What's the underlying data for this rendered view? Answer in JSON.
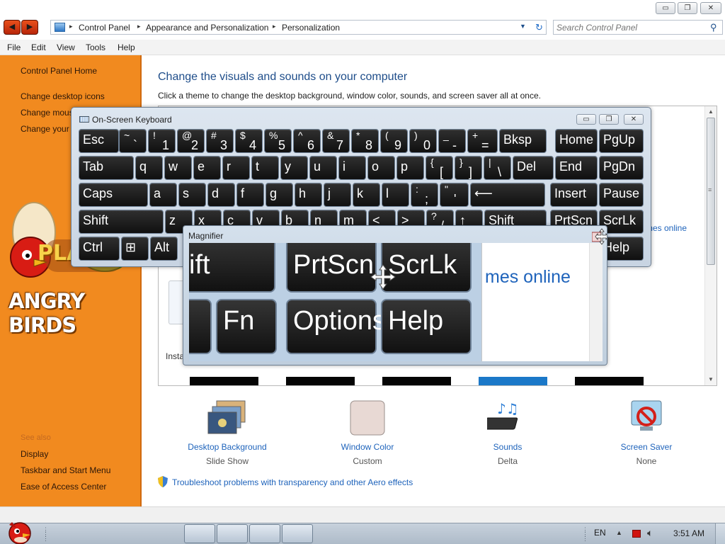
{
  "window": {
    "controls": {
      "minimize": "▭",
      "maximize": "❐",
      "close": "✕"
    }
  },
  "address": {
    "crumbs": [
      "Control Panel",
      "Appearance and Personalization",
      "Personalization"
    ],
    "arrow": "▸",
    "dropdown": "▼",
    "refresh": "↻"
  },
  "search": {
    "placeholder": "Search Control Panel",
    "icon": "search-icon"
  },
  "menu": [
    "File",
    "Edit",
    "View",
    "Tools",
    "Help"
  ],
  "sidebar": {
    "links": [
      "Control Panel Home",
      "Change desktop icons",
      "Change mouse pointers",
      "Change your account picture"
    ],
    "see_also_title": "See also",
    "see_also": [
      "Display",
      "Taskbar and Start Menu",
      "Ease of Access Center"
    ],
    "art_play": "PLAY",
    "art_title": "ANGRY BIRDS"
  },
  "main": {
    "title": "Change the visuals and sounds on your computer",
    "description": "Click a theme to change the desktop background, window color, sounds, and screen saver all at once.",
    "themes_online": "mes online",
    "installed_label": "Insta",
    "bottom_items": [
      {
        "label": "Desktop Background",
        "sub": "Slide Show",
        "icon": "desktop-background-icon"
      },
      {
        "label": "Window Color",
        "sub": "Custom",
        "icon": "window-color-icon"
      },
      {
        "label": "Sounds",
        "sub": "Delta",
        "icon": "sounds-icon"
      },
      {
        "label": "Screen Saver",
        "sub": "None",
        "icon": "screen-saver-icon"
      }
    ],
    "troubleshoot": "Troubleshoot problems with transparency and other Aero effects"
  },
  "osk": {
    "title": "On-Screen Keyboard",
    "keys": {
      "row1": [
        {
          "t": "Esc"
        },
        {
          "t": "~",
          "b": "`"
        },
        {
          "t": "!",
          "b": "1"
        },
        {
          "t": "@",
          "b": "2"
        },
        {
          "t": "#",
          "b": "3"
        },
        {
          "t": "$",
          "b": "4"
        },
        {
          "t": "%",
          "b": "5"
        },
        {
          "t": "^",
          "b": "6"
        },
        {
          "t": "&",
          "b": "7"
        },
        {
          "t": "*",
          "b": "8"
        },
        {
          "t": "(",
          "b": "9"
        },
        {
          "t": ")",
          "b": "0"
        },
        {
          "t": "_",
          "b": "-"
        },
        {
          "t": "+",
          "b": "="
        },
        {
          "t": "Bksp"
        },
        {
          "t": "Home"
        },
        {
          "t": "PgUp"
        }
      ],
      "row2": [
        {
          "t": "Tab"
        },
        {
          "t": "q"
        },
        {
          "t": "w"
        },
        {
          "t": "e"
        },
        {
          "t": "r"
        },
        {
          "t": "t"
        },
        {
          "t": "y"
        },
        {
          "t": "u"
        },
        {
          "t": "i"
        },
        {
          "t": "o"
        },
        {
          "t": "p"
        },
        {
          "t": "{",
          "b": "["
        },
        {
          "t": "}",
          "b": "]"
        },
        {
          "t": "|",
          "b": "\\"
        },
        {
          "t": "Del"
        },
        {
          "t": "End"
        },
        {
          "t": "PgDn"
        }
      ],
      "row3": [
        {
          "t": "Caps"
        },
        {
          "t": "a"
        },
        {
          "t": "s"
        },
        {
          "t": "d"
        },
        {
          "t": "f"
        },
        {
          "t": "g"
        },
        {
          "t": "h"
        },
        {
          "t": "j"
        },
        {
          "t": "k"
        },
        {
          "t": "l"
        },
        {
          "t": ":",
          "b": ";"
        },
        {
          "t": "\"",
          "b": "'"
        },
        {
          "t": "⟵"
        },
        {
          "t": "Insert"
        },
        {
          "t": "Pause"
        }
      ],
      "row4": [
        {
          "t": "Shift"
        },
        {
          "t": "z"
        },
        {
          "t": "x"
        },
        {
          "t": "c"
        },
        {
          "t": "v"
        },
        {
          "t": "b"
        },
        {
          "t": "n"
        },
        {
          "t": "m"
        },
        {
          "t": "<"
        },
        {
          "t": ">"
        },
        {
          "t": "?",
          "b": "/"
        },
        {
          "t": "↑"
        },
        {
          "t": "Shift"
        },
        {
          "t": "PrtScn"
        },
        {
          "t": "ScrLk"
        }
      ],
      "row5": [
        {
          "t": "Ctrl"
        },
        {
          "t": "⊞"
        },
        {
          "t": "Alt"
        },
        {
          "t": "Help"
        }
      ]
    }
  },
  "magnifier": {
    "title": "Magnifier",
    "keys": [
      "ift",
      "PrtScn",
      "ScrLk",
      "",
      "Fn",
      "Options",
      "Help"
    ],
    "online_text": "mes online"
  },
  "taskbar": {
    "language": "EN",
    "time": "3:51 AM"
  },
  "colors": {
    "sidebar": "#f18a1f",
    "link": "#1e63bb",
    "title": "#1e4d8a"
  }
}
